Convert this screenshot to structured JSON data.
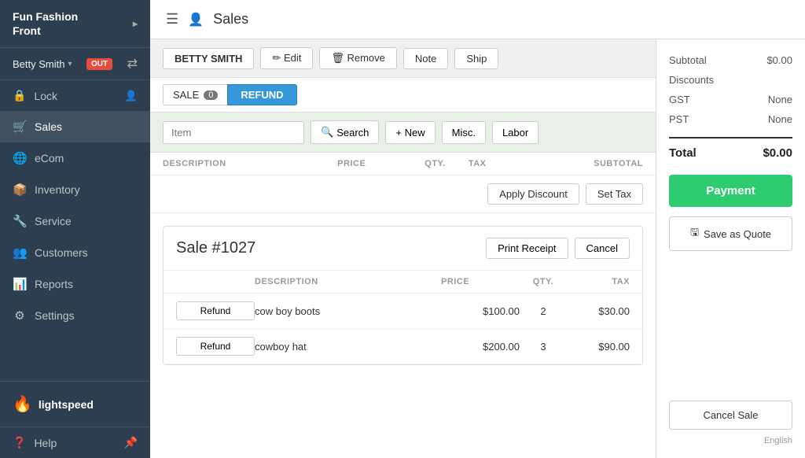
{
  "app": {
    "name_line1": "Fun Fashion",
    "name_line2": "Front",
    "title": "Fun Fashion Front"
  },
  "user": {
    "name": "Betty Smith",
    "status": "OUT"
  },
  "nav": {
    "lock": "Lock",
    "sales": "Sales",
    "ecom": "eCom",
    "inventory": "Inventory",
    "service": "Service",
    "customers": "Customers",
    "reports": "Reports",
    "settings": "Settings",
    "help": "Help"
  },
  "header": {
    "page_icon": "👤",
    "page_title": "Sales"
  },
  "customer_bar": {
    "customer_name": "BETTY SMITH",
    "edit_label": "✏ Edit",
    "remove_label": "🗑 Remove",
    "note_label": "Note",
    "ship_label": "Ship"
  },
  "sale_tabs": {
    "sale_label": "SALE",
    "sale_count": "0",
    "refund_label": "REFUND"
  },
  "item_row": {
    "item_placeholder": "Item",
    "search_label": "Search",
    "new_label": "+ New",
    "misc_label": "Misc.",
    "labor_label": "Labor"
  },
  "table_columns": {
    "description": "DESCRIPTION",
    "price": "PRICE",
    "qty": "QTY.",
    "tax": "TAX",
    "subtotal": "SUBTOTAL"
  },
  "discount_row": {
    "apply_discount": "Apply Discount",
    "set_tax": "Set Tax"
  },
  "refund_card": {
    "sale_number": "Sale #1027",
    "print_receipt": "Print Receipt",
    "cancel": "Cancel"
  },
  "refund_table": {
    "columns": {
      "description": "DESCRIPTION",
      "price": "PRICE",
      "qty": "QTY.",
      "tax": "TAX"
    },
    "rows": [
      {
        "btn": "Refund",
        "description": "cow boy boots",
        "price": "$100.00",
        "qty": "2",
        "tax": "$30.00"
      },
      {
        "btn": "Refund",
        "description": "cowboy hat",
        "price": "$200.00",
        "qty": "3",
        "tax": "$90.00"
      }
    ]
  },
  "summary": {
    "subtotal_label": "Subtotal",
    "subtotal_value": "$0.00",
    "discounts_label": "Discounts",
    "discounts_value": "",
    "gst_label": "GST",
    "gst_value": "None",
    "pst_label": "PST",
    "pst_value": "None",
    "total_label": "Total",
    "total_value": "$0.00"
  },
  "actions": {
    "payment": "Payment",
    "save_quote_icon": "🖫",
    "save_quote": "Save as Quote",
    "cancel_sale": "Cancel Sale"
  },
  "footer": {
    "language": "English"
  },
  "lightspeed": {
    "label": "lightspeed"
  }
}
